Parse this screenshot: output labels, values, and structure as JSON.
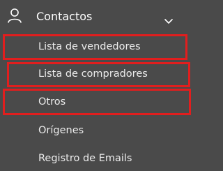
{
  "menu": {
    "header": {
      "label": "Contactos",
      "icon": "user-icon",
      "expand_icon": "chevron-down-icon"
    },
    "items": [
      {
        "label": "Lista de vendedores",
        "highlighted": true
      },
      {
        "label": "Lista de compradores",
        "highlighted": true
      },
      {
        "label": "Otros",
        "highlighted": true
      },
      {
        "label": "Orígenes",
        "highlighted": false
      },
      {
        "label": "Registro de Emails",
        "highlighted": false
      }
    ]
  },
  "colors": {
    "background": "#4a4a4a",
    "text": "#ffffff",
    "highlight": "#e11e1e"
  }
}
